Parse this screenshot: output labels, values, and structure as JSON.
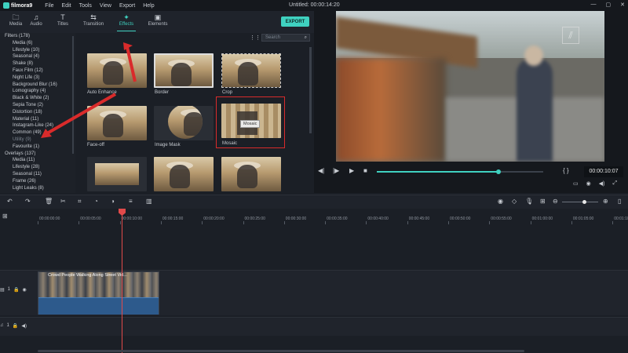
{
  "titlebar": {
    "app_name": "filmora9",
    "menu": [
      "File",
      "Edit",
      "Tools",
      "View",
      "Export",
      "Help"
    ],
    "title": "Untitled:  00:00:14:20",
    "window_controls": [
      "—",
      "▢",
      "✕"
    ]
  },
  "tabs": [
    {
      "label": "Media",
      "icon": "folder-icon",
      "glyph": "🗀"
    },
    {
      "label": "Audio",
      "icon": "music-note-icon",
      "glyph": "♫"
    },
    {
      "label": "Titles",
      "icon": "text-icon",
      "glyph": "T"
    },
    {
      "label": "Transition",
      "icon": "transition-icon",
      "glyph": "⇆"
    },
    {
      "label": "Effects",
      "icon": "effects-icon",
      "glyph": "✦",
      "active": true
    },
    {
      "label": "Elements",
      "icon": "image-icon",
      "glyph": "▣"
    }
  ],
  "export_label": "EXPORT",
  "sidebar": {
    "items": [
      {
        "label": "Filters (178)",
        "level": 0
      },
      {
        "label": "Media (6)",
        "level": 1
      },
      {
        "label": "Lifestyle (10)",
        "level": 1
      },
      {
        "label": "Seasonal (4)",
        "level": 1
      },
      {
        "label": "Shake (8)",
        "level": 1
      },
      {
        "label": "Faux Film (12)",
        "level": 1
      },
      {
        "label": "Night Life (3)",
        "level": 1
      },
      {
        "label": "Background Blur (16)",
        "level": 1
      },
      {
        "label": "Lomography (4)",
        "level": 1
      },
      {
        "label": "Black & White (2)",
        "level": 1
      },
      {
        "label": "Sepia Tone (2)",
        "level": 1
      },
      {
        "label": "Distortion (18)",
        "level": 1
      },
      {
        "label": "Material (11)",
        "level": 1
      },
      {
        "label": "Instagram-Like (24)",
        "level": 1
      },
      {
        "label": "Common (49)",
        "level": 1
      },
      {
        "label": "Utility (9)",
        "level": 1,
        "highlight": true
      },
      {
        "label": "Favourite (1)",
        "level": 1
      },
      {
        "label": "Overlays (137)",
        "level": 0
      },
      {
        "label": "Media (11)",
        "level": 1
      },
      {
        "label": "Lifestyle (28)",
        "level": 1
      },
      {
        "label": "Seasonal (11)",
        "level": 1
      },
      {
        "label": "Frame (26)",
        "level": 1
      },
      {
        "label": "Light Leaks (8)",
        "level": 1
      }
    ]
  },
  "search": {
    "placeholder": "Search"
  },
  "effects": [
    {
      "label": "Auto Enhance"
    },
    {
      "label": "Border"
    },
    {
      "label": "Crop"
    },
    {
      "label": "Face-off"
    },
    {
      "label": "Image Mask"
    },
    {
      "label": "Mosaic",
      "selected": true
    },
    {
      "label": ""
    },
    {
      "label": ""
    },
    {
      "label": ""
    }
  ],
  "tooltip": "Mosaic",
  "preview": {
    "timecode": "00:00:10:07",
    "progress": 0.73,
    "brackets": "{   }"
  },
  "ruler": {
    "ticks": [
      "00:00:00:00",
      "00:00:05:00",
      "00:00:10:00",
      "00:00:15:00",
      "00:00:20:00",
      "00:00:25:00",
      "00:00:30:00",
      "00:00:35:00",
      "00:00:40:00",
      "00:00:45:00",
      "00:00:50:00",
      "00:00:55:00",
      "00:01:00:00",
      "00:01:05:00",
      "00:01:10:00"
    ]
  },
  "tracks": {
    "video_label": "1",
    "audio_label": "1",
    "clip_title": "Crowd People Walking Along Street Vid..."
  },
  "zoom": 0.6,
  "colors": {
    "accent": "#3fd1c0",
    "playhead": "#e24a4a",
    "annotation": "#d92b2b"
  }
}
